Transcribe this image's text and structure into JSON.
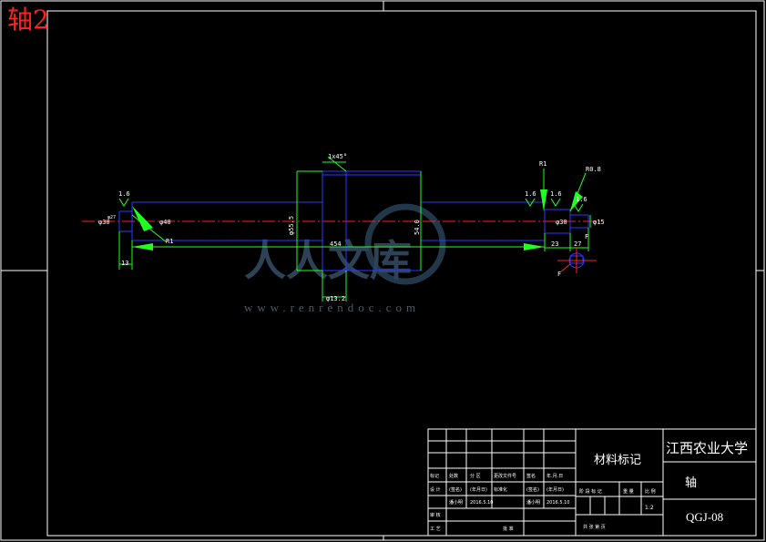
{
  "sheet": {
    "title": "轴2"
  },
  "watermark": {
    "text_cn": "人人文库",
    "url": "www.renrendoc.com"
  },
  "dimensions": {
    "chamfer": "1x45°",
    "roughness_1": "1.6",
    "roughness_2": "1.6",
    "roughness_3": "1.6",
    "roughness_4": "1.6",
    "left_dia_small": "φ30",
    "left_dia_small_sub": "φ27",
    "left_dia": "φ40",
    "left_radius": "R1",
    "collar_dia": "φ55.5",
    "collar_tol": "54.0",
    "overall_length": "454",
    "collar_width": "φ13.2",
    "left_end_len": "13",
    "right_radius_1": "R1",
    "right_radius_2": "R0.8",
    "right_dia": "φ30",
    "right_dia_small": "φ15",
    "right_len_1": "23",
    "right_len_2": "27",
    "section_label_1": "F",
    "section_label_2": "F"
  },
  "title_block": {
    "school": "江西农业大学",
    "material": "材料标记",
    "part_name": "轴",
    "drawing_no": "QGJ-08",
    "scale": "1:2",
    "row_headers": [
      "标记",
      "处数",
      "分 区",
      "更改文件号",
      "签名",
      "年.月.日"
    ],
    "design_row": [
      "设 计",
      "(签名)",
      "(年月日)",
      "标准化",
      "(签名)",
      "(年月日)"
    ],
    "sign_row": [
      "",
      "潘小明",
      "2016.5.10",
      "",
      "潘小明",
      "2016.5.10"
    ],
    "review_label": "审 核",
    "process_label": "工 艺",
    "approve_label": "批 准",
    "stage_labels": [
      "阶 段 标 记",
      "重 量",
      "比 例"
    ],
    "sheet_info": "共   张   第   页"
  }
}
